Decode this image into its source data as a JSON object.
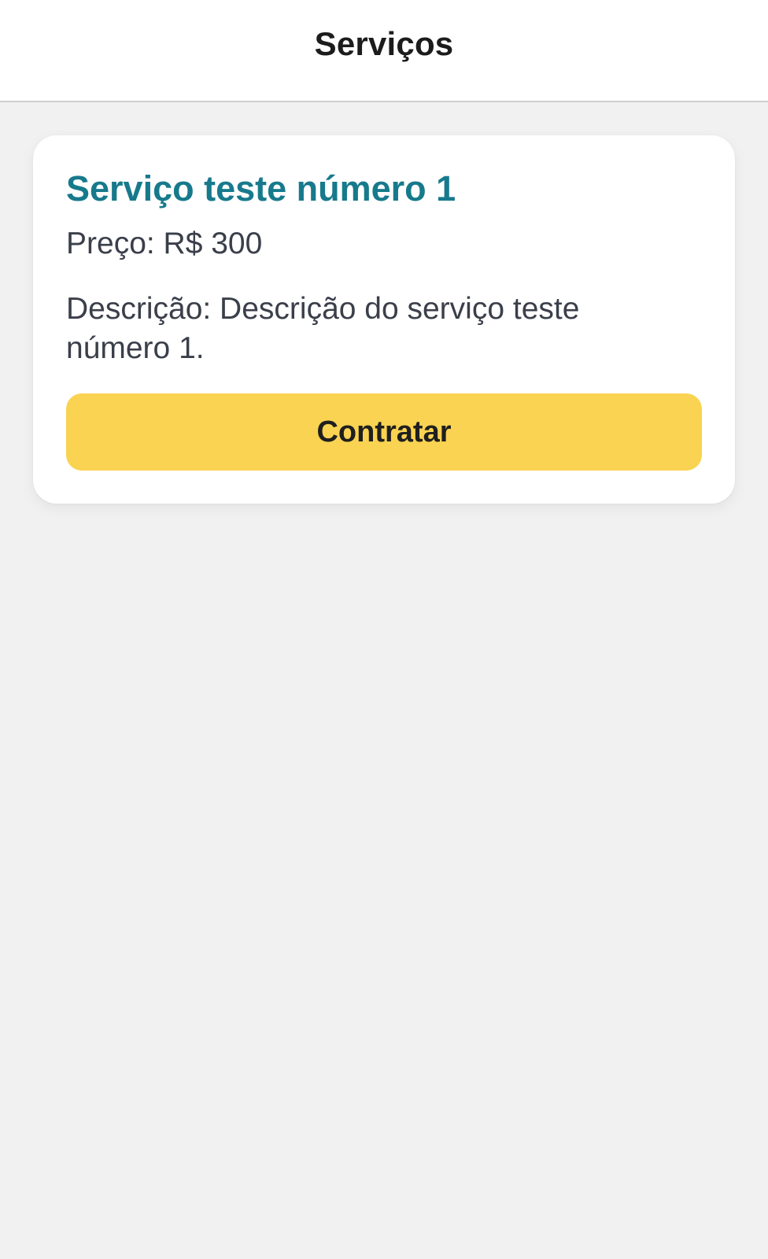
{
  "header": {
    "title": "Serviços"
  },
  "service": {
    "title": "Serviço teste número 1",
    "price": "Preço: R$ 300",
    "description": "Descrição: Descrição do serviço teste número 1.",
    "button_label": "Contratar"
  },
  "colors": {
    "title_accent": "#177a8c",
    "button_bg": "#f9d351",
    "page_bg": "#f1f1f1"
  }
}
